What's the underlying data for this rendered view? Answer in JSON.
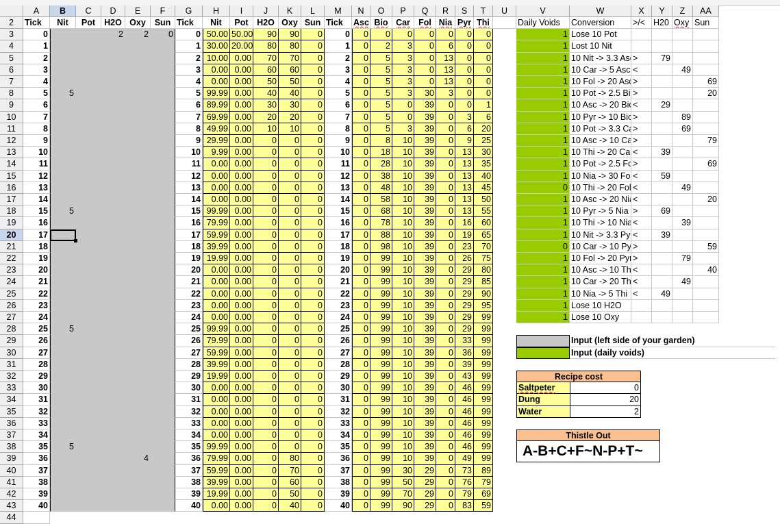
{
  "columns": [
    "A",
    "B",
    "C",
    "D",
    "E",
    "F",
    "G",
    "H",
    "I",
    "J",
    "K",
    "L",
    "M",
    "N",
    "O",
    "P",
    "Q",
    "R",
    "S",
    "T",
    "U",
    "V",
    "W",
    "X",
    "Y",
    "Z",
    "AA"
  ],
  "selected_column": "B",
  "selected_row": 20,
  "rows": [
    2,
    3,
    4,
    5,
    6,
    7,
    8,
    9,
    10,
    11,
    12,
    13,
    14,
    15,
    16,
    17,
    18,
    19,
    20,
    21,
    22,
    23,
    24,
    25,
    26,
    27,
    28,
    29,
    30,
    31,
    32,
    33,
    34,
    35,
    36,
    37,
    38,
    39,
    40,
    41,
    42,
    43,
    44
  ],
  "headers": {
    "left": [
      "Tick",
      "Nit",
      "Pot",
      "H2O",
      "Oxy",
      "Sun"
    ],
    "mid": [
      "Tick",
      "Nit",
      "Pot",
      "H2O",
      "Oxy",
      "Sun"
    ],
    "right": [
      "Tick",
      "Asc",
      "Bio",
      "Car",
      "Fol",
      "Nia",
      "Pyr",
      "Thi"
    ],
    "conv": [
      "Daily Voids",
      "Conversion",
      ">/<",
      "H20",
      "Oxy",
      "Sun"
    ]
  },
  "left_inputs": {
    "row0": [
      "",
      "2",
      "2",
      "0"
    ],
    "nit_marks": {
      "5": "5",
      "15": "5",
      "25": "5",
      "35": "5"
    },
    "oxy_marks": {
      "36": "4"
    }
  },
  "mid_table": [
    [
      "50.00",
      "50.00",
      "90",
      "90",
      "0"
    ],
    [
      "30.00",
      "20.00",
      "80",
      "80",
      "0"
    ],
    [
      "10.00",
      "0.00",
      "70",
      "70",
      "0"
    ],
    [
      "0.00",
      "0.00",
      "60",
      "60",
      "0"
    ],
    [
      "0.00",
      "0.00",
      "50",
      "50",
      "0"
    ],
    [
      "99.99",
      "0.00",
      "40",
      "40",
      "0"
    ],
    [
      "89.99",
      "0.00",
      "30",
      "30",
      "0"
    ],
    [
      "69.99",
      "0.00",
      "20",
      "20",
      "0"
    ],
    [
      "49.99",
      "0.00",
      "10",
      "10",
      "0"
    ],
    [
      "29.99",
      "0.00",
      "0",
      "0",
      "0"
    ],
    [
      "9.99",
      "0.00",
      "0",
      "0",
      "0"
    ],
    [
      "0.00",
      "0.00",
      "0",
      "0",
      "0"
    ],
    [
      "0.00",
      "0.00",
      "0",
      "0",
      "0"
    ],
    [
      "0.00",
      "0.00",
      "0",
      "0",
      "0"
    ],
    [
      "0.00",
      "0.00",
      "0",
      "0",
      "0"
    ],
    [
      "99.99",
      "0.00",
      "0",
      "0",
      "0"
    ],
    [
      "79.99",
      "0.00",
      "0",
      "0",
      "0"
    ],
    [
      "59.99",
      "0.00",
      "0",
      "0",
      "0"
    ],
    [
      "39.99",
      "0.00",
      "0",
      "0",
      "0"
    ],
    [
      "19.99",
      "0.00",
      "0",
      "0",
      "0"
    ],
    [
      "0.00",
      "0.00",
      "0",
      "0",
      "0"
    ],
    [
      "0.00",
      "0.00",
      "0",
      "0",
      "0"
    ],
    [
      "0.00",
      "0.00",
      "0",
      "0",
      "0"
    ],
    [
      "0.00",
      "0.00",
      "0",
      "0",
      "0"
    ],
    [
      "0.00",
      "0.00",
      "0",
      "0",
      "0"
    ],
    [
      "99.99",
      "0.00",
      "0",
      "0",
      "0"
    ],
    [
      "79.99",
      "0.00",
      "0",
      "0",
      "0"
    ],
    [
      "59.99",
      "0.00",
      "0",
      "0",
      "0"
    ],
    [
      "39.99",
      "0.00",
      "0",
      "0",
      "0"
    ],
    [
      "19.99",
      "0.00",
      "0",
      "0",
      "0"
    ],
    [
      "0.00",
      "0.00",
      "0",
      "0",
      "0"
    ],
    [
      "0.00",
      "0.00",
      "0",
      "0",
      "0"
    ],
    [
      "0.00",
      "0.00",
      "0",
      "0",
      "0"
    ],
    [
      "0.00",
      "0.00",
      "0",
      "0",
      "0"
    ],
    [
      "0.00",
      "0.00",
      "0",
      "0",
      "0"
    ],
    [
      "99.99",
      "0.00",
      "0",
      "0",
      "0"
    ],
    [
      "79.99",
      "0.00",
      "0",
      "80",
      "0"
    ],
    [
      "59.99",
      "0.00",
      "0",
      "70",
      "0"
    ],
    [
      "39.99",
      "0.00",
      "0",
      "60",
      "0"
    ],
    [
      "19.99",
      "0.00",
      "0",
      "50",
      "0"
    ],
    [
      "0.00",
      "0.00",
      "0",
      "40",
      "0"
    ]
  ],
  "right_table": [
    [
      "0",
      "0",
      "0",
      "0",
      "0",
      "0",
      "0"
    ],
    [
      "0",
      "2",
      "3",
      "0",
      "6",
      "0",
      "0"
    ],
    [
      "0",
      "5",
      "3",
      "0",
      "13",
      "0",
      "0"
    ],
    [
      "0",
      "5",
      "3",
      "0",
      "13",
      "0",
      "0"
    ],
    [
      "0",
      "5",
      "3",
      "0",
      "13",
      "0",
      "0"
    ],
    [
      "0",
      "5",
      "3",
      "30",
      "3",
      "0",
      "0"
    ],
    [
      "0",
      "5",
      "0",
      "39",
      "0",
      "0",
      "1"
    ],
    [
      "0",
      "5",
      "0",
      "39",
      "0",
      "3",
      "6"
    ],
    [
      "0",
      "5",
      "3",
      "39",
      "0",
      "6",
      "20"
    ],
    [
      "0",
      "8",
      "10",
      "39",
      "0",
      "9",
      "25"
    ],
    [
      "0",
      "18",
      "10",
      "39",
      "0",
      "13",
      "30"
    ],
    [
      "0",
      "28",
      "10",
      "39",
      "0",
      "13",
      "35"
    ],
    [
      "0",
      "38",
      "10",
      "39",
      "0",
      "13",
      "40"
    ],
    [
      "0",
      "48",
      "10",
      "39",
      "0",
      "13",
      "45"
    ],
    [
      "0",
      "58",
      "10",
      "39",
      "0",
      "13",
      "50"
    ],
    [
      "0",
      "68",
      "10",
      "39",
      "0",
      "13",
      "55"
    ],
    [
      "0",
      "78",
      "10",
      "39",
      "0",
      "16",
      "60"
    ],
    [
      "0",
      "88",
      "10",
      "39",
      "0",
      "19",
      "65"
    ],
    [
      "0",
      "98",
      "10",
      "39",
      "0",
      "23",
      "70"
    ],
    [
      "0",
      "99",
      "10",
      "39",
      "0",
      "26",
      "75"
    ],
    [
      "0",
      "99",
      "10",
      "39",
      "0",
      "29",
      "80"
    ],
    [
      "0",
      "99",
      "10",
      "39",
      "0",
      "29",
      "85"
    ],
    [
      "0",
      "99",
      "10",
      "39",
      "0",
      "29",
      "90"
    ],
    [
      "0",
      "99",
      "10",
      "39",
      "0",
      "29",
      "95"
    ],
    [
      "0",
      "99",
      "10",
      "39",
      "0",
      "29",
      "99"
    ],
    [
      "0",
      "99",
      "10",
      "39",
      "0",
      "29",
      "99"
    ],
    [
      "0",
      "99",
      "10",
      "39",
      "0",
      "33",
      "99"
    ],
    [
      "0",
      "99",
      "10",
      "39",
      "0",
      "36",
      "99"
    ],
    [
      "0",
      "99",
      "10",
      "39",
      "0",
      "39",
      "99"
    ],
    [
      "0",
      "99",
      "10",
      "39",
      "0",
      "43",
      "99"
    ],
    [
      "0",
      "99",
      "10",
      "39",
      "0",
      "46",
      "99"
    ],
    [
      "0",
      "99",
      "10",
      "39",
      "0",
      "46",
      "99"
    ],
    [
      "0",
      "99",
      "10",
      "39",
      "0",
      "46",
      "99"
    ],
    [
      "0",
      "99",
      "10",
      "39",
      "0",
      "46",
      "99"
    ],
    [
      "0",
      "99",
      "10",
      "39",
      "0",
      "46",
      "99"
    ],
    [
      "0",
      "99",
      "10",
      "39",
      "0",
      "46",
      "99"
    ],
    [
      "0",
      "99",
      "10",
      "39",
      "0",
      "49",
      "99"
    ],
    [
      "0",
      "99",
      "30",
      "29",
      "0",
      "73",
      "89"
    ],
    [
      "0",
      "99",
      "50",
      "29",
      "0",
      "76",
      "79"
    ],
    [
      "0",
      "99",
      "70",
      "29",
      "0",
      "79",
      "69"
    ],
    [
      "0",
      "99",
      "90",
      "29",
      "0",
      "83",
      "59"
    ]
  ],
  "conversions": [
    [
      "1",
      "Lose 10 Pot",
      "",
      "",
      "",
      ""
    ],
    [
      "1",
      "Lost 10 Nit",
      "",
      "",
      "",
      ""
    ],
    [
      "1",
      "10 Nit -> 3.3 Asc",
      ">",
      "79",
      "",
      ""
    ],
    [
      "1",
      "10 Car -> 5 Asc",
      "<",
      "",
      "49",
      ""
    ],
    [
      "1",
      "10 Fol -> 20 Asc",
      ">",
      "",
      "",
      "69"
    ],
    [
      "1",
      "10 Pot -> 2.5 Bio",
      ">",
      "",
      "",
      "20"
    ],
    [
      "1",
      "10 Asc -> 20 Bio",
      "<",
      "29",
      "",
      ""
    ],
    [
      "1",
      "10 Pyr -> 10 Bio",
      ">",
      "",
      "89",
      ""
    ],
    [
      "1",
      "10 Pot -> 3.3 Car",
      ">",
      "",
      "69",
      ""
    ],
    [
      "1",
      "10 Asc -> 10 Car",
      ">",
      "",
      "",
      "79"
    ],
    [
      "1",
      "10 Thi -> 20 Car",
      "<",
      "39",
      "",
      ""
    ],
    [
      "1",
      "10 Pot -> 2.5 Fol",
      ">",
      "",
      "",
      "69"
    ],
    [
      "1",
      "10 Nia -> 30 Fol",
      "<",
      "59",
      "",
      ""
    ],
    [
      "0",
      "10 Thi -> 20 Fol",
      "<",
      "",
      "49",
      ""
    ],
    [
      "1",
      "10 Asc -> 20 Nia",
      "<",
      "",
      "",
      "20"
    ],
    [
      "1",
      "10 Pyr -> 5 Nia",
      ">",
      "69",
      "",
      ""
    ],
    [
      "1",
      "10 Thi -> 10 Nia",
      "<",
      "",
      "39",
      ""
    ],
    [
      "1",
      "10 Nit -> 3.3 Pyr",
      "<",
      "39",
      "",
      ""
    ],
    [
      "0",
      "10 Car -> 10 Pyr",
      ">",
      "",
      "",
      "59"
    ],
    [
      "1",
      "10 Fol -> 20 Pyr",
      ">",
      "",
      "79",
      ""
    ],
    [
      "1",
      "10 Asc -> 10 Thi",
      "<",
      "",
      "",
      "40"
    ],
    [
      "1",
      "10 Car -> 20 Thi",
      "<",
      "",
      "49",
      ""
    ],
    [
      "1",
      "10 Nia -> 5 Thi",
      "<",
      "49",
      "",
      ""
    ],
    [
      "1",
      "Lose 10 H2O",
      "",
      "",
      "",
      ""
    ],
    [
      "1",
      "Lose 10 Oxy",
      "",
      "",
      "",
      ""
    ]
  ],
  "legend": {
    "gray": "Input (left side of your garden)",
    "green": "Input (daily voids)"
  },
  "recipe": {
    "title": "Recipe cost",
    "items": [
      [
        "Saltpeter",
        "0"
      ],
      [
        "Dung",
        "20"
      ],
      [
        "Water",
        "2"
      ]
    ]
  },
  "thistle": {
    "title": "Thistle Out",
    "value": "A-B+C+F~N-P+T~"
  },
  "colors": {
    "gray": "#c8c8c8",
    "yellow": "#ffff99",
    "green": "#99cc00",
    "orange": "#fac090",
    "header": "#efefef",
    "selected": "#c9d7ee"
  }
}
